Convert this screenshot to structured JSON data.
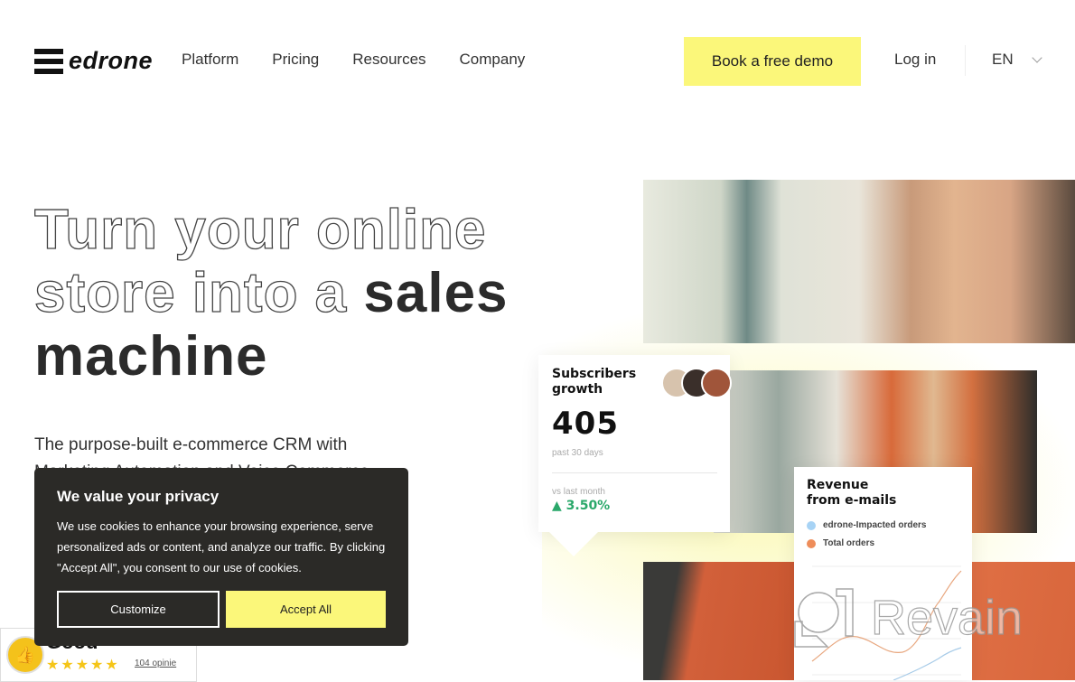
{
  "header": {
    "logo_text": "edrone",
    "nav": [
      "Platform",
      "Pricing",
      "Resources",
      "Company"
    ],
    "cta_label": "Book a free demo",
    "login_label": "Log in",
    "language": "EN"
  },
  "hero": {
    "line1_outline": "Turn your online",
    "line2_outline": "store into a ",
    "line2_solid": "sales",
    "line3_solid": "machine",
    "subtitle_line1": "The purpose-built e-commerce CRM with",
    "subtitle_line2": "Marketing Automation and Voice Commerce"
  },
  "subscribers_card": {
    "title": "Subscribers growth",
    "value": "405",
    "period": "past 30 days",
    "compare_label": "vs last month",
    "change": "▲ 3.50%",
    "change_color": "#2aa86a"
  },
  "revenue_card": {
    "title_line1": "Revenue",
    "title_line2": "from e-mails",
    "legend": [
      {
        "label": "edrone-Impacted orders",
        "color": "#a7d3f5"
      },
      {
        "label": "Total orders",
        "color": "#ee8d5a"
      }
    ]
  },
  "cookie_banner": {
    "title": "We value your privacy",
    "body": "We use cookies to enhance your browsing experience, serve personalized ads or content, and analyze our traffic. By clicking \"Accept All\", you consent to our use of cookies.",
    "customize_label": "Customize",
    "accept_label": "Accept All"
  },
  "rating_widget": {
    "word": "Good",
    "stars": 5,
    "reviews_label": "104 opinie"
  },
  "watermark": {
    "text": "Revain"
  },
  "colors": {
    "accent_yellow": "#fbf77a",
    "cookie_bg": "#2b2a27"
  }
}
